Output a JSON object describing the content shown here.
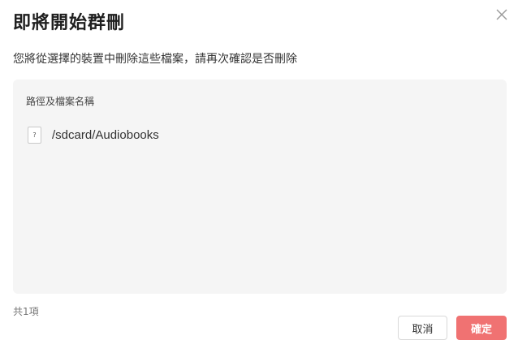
{
  "dialog": {
    "title": "即將開始群刪",
    "subtitle": "您將從選擇的裝置中刪除這些檔案，請再次確認是否刪除",
    "close_icon": "close-icon"
  },
  "file_list": {
    "column_header": "路徑及檔案名稱",
    "items": [
      {
        "icon": "unknown-file-icon",
        "icon_glyph": "?",
        "path": "/sdcard/Audiobooks"
      }
    ]
  },
  "footer": {
    "count_text": "共1項",
    "cancel_label": "取消",
    "confirm_label": "確定"
  },
  "colors": {
    "confirm_button": "#f07272",
    "panel_background": "#f5f5f5"
  }
}
